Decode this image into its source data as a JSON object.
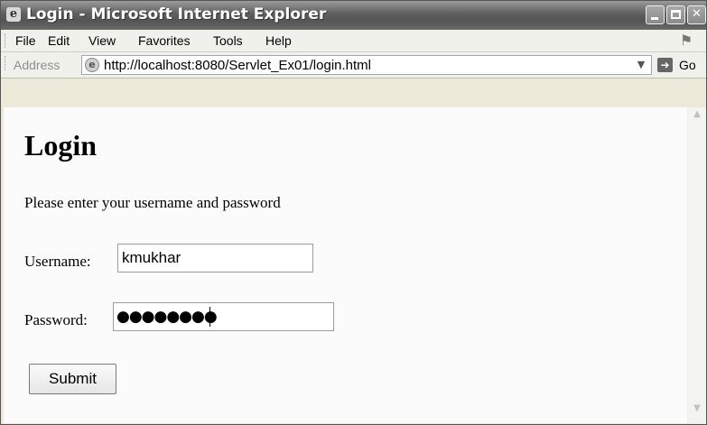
{
  "window": {
    "title": "Login - Microsoft Internet Explorer",
    "icon": "ie-icon",
    "controls": [
      "minimize-button",
      "maximize-button",
      "close-button"
    ]
  },
  "menubar": {
    "items": [
      "File",
      "Edit",
      "View",
      "Favorites",
      "Tools",
      "Help"
    ]
  },
  "addressbar": {
    "label": "Address",
    "url": "http://localhost:8080/Servlet_Ex01/login.html",
    "go_label": "Go"
  },
  "page": {
    "heading": "Login",
    "instructions": "Please enter your username and password",
    "username_label": "Username:",
    "username_value": "kmukhar",
    "password_label": "Password:",
    "password_masked": "●●●●●●●●",
    "submit_label": "Submit"
  }
}
